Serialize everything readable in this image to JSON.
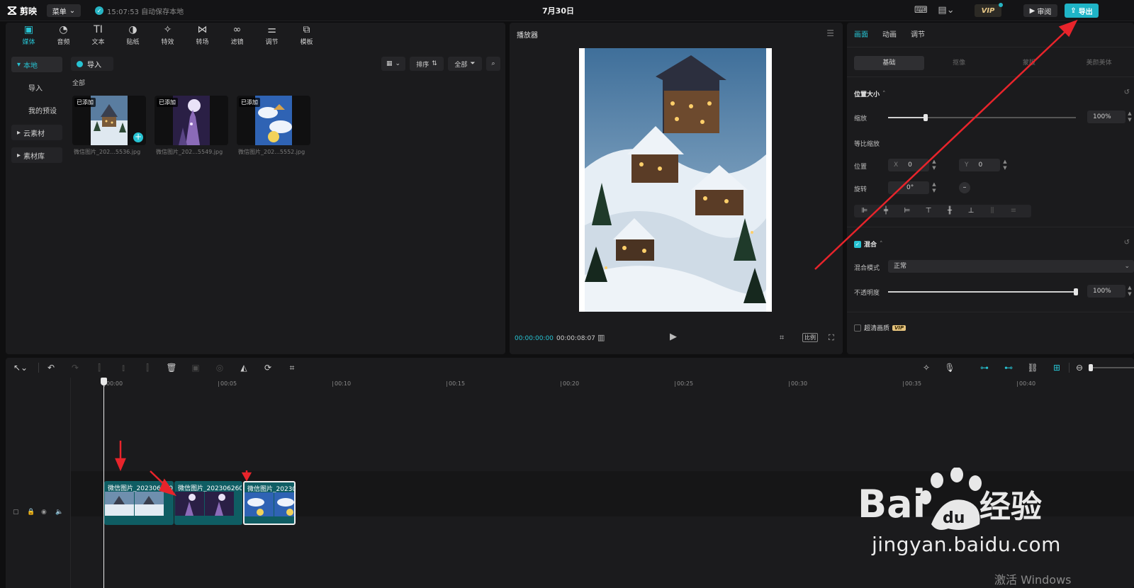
{
  "titlebar": {
    "logo": "剪映",
    "menu_label": "菜单",
    "save_status": "15:07:53 自动保存本地",
    "project_title": "7月30日",
    "vip_label": "VIP",
    "review_label": "审阅",
    "export_label": "导出"
  },
  "media": {
    "tools": [
      {
        "label": "媒体",
        "icon": "media-icon"
      },
      {
        "label": "音频",
        "icon": "audio-icon"
      },
      {
        "label": "文本",
        "icon": "text-icon"
      },
      {
        "label": "贴纸",
        "icon": "sticker-icon"
      },
      {
        "label": "特效",
        "icon": "effects-icon"
      },
      {
        "label": "转场",
        "icon": "transition-icon"
      },
      {
        "label": "滤镜",
        "icon": "filter-icon"
      },
      {
        "label": "调节",
        "icon": "adjust-icon"
      },
      {
        "label": "模板",
        "icon": "template-icon"
      }
    ],
    "nav": {
      "local": "本地",
      "import": "导入",
      "my_presets": "我的预设",
      "cloud": "云素材",
      "library": "素材库"
    },
    "import_label": "导入",
    "section_all": "全部",
    "sort_label": "排序",
    "filter_label": "全部",
    "thumbnails": [
      {
        "badge": "已添加",
        "name": "微信图片_202...5536.jpg"
      },
      {
        "badge": "已添加",
        "name": "微信图片_202...5549.jpg"
      },
      {
        "badge": "已添加",
        "name": "微信图片_202...5552.jpg"
      }
    ]
  },
  "player": {
    "title": "播放器",
    "current_time": "00:00:00:00",
    "total_time": "00:00:08:07",
    "ratio_label": "比例"
  },
  "props": {
    "tabs": [
      "画面",
      "动画",
      "调节"
    ],
    "subtabs": [
      "基础",
      "抠像",
      "蒙版",
      "美颜美体"
    ],
    "section_position": "位置大小",
    "scale_label": "缩放",
    "scale_value": "100%",
    "scale_fraction": 0.2,
    "uniform_scale_label": "等比缩放",
    "position_label": "位置",
    "pos_x_axis": "X",
    "pos_x": "0",
    "pos_y_axis": "Y",
    "pos_y": "0",
    "rotate_label": "旋转",
    "rotate_value": "0°",
    "section_blend": "混合",
    "blend_mode_label": "混合模式",
    "blend_mode_value": "正常",
    "opacity_label": "不透明度",
    "opacity_value": "100%",
    "opacity_fraction": 1.0,
    "hd_label": "超清画质",
    "hd_vip": "VIP"
  },
  "timeline": {
    "ticks": [
      "00:00",
      "00:05",
      "00:10",
      "00:15",
      "00:20",
      "00:25",
      "00:30",
      "00:35",
      "00:40"
    ],
    "cover_label": "封面",
    "clips": [
      {
        "name": "微信图片_202306260005"
      },
      {
        "name": "微信图片_202306260005"
      },
      {
        "name": "微信图片_202306"
      }
    ]
  },
  "watermark": {
    "text": "jingyan.baidu.com",
    "brand": "Bai du 经验"
  },
  "os": {
    "activate": "激活 Windows"
  },
  "colors": {
    "accent": "#27c3d3",
    "export": "#1fb4c7",
    "clip": "#0f5d63",
    "annotation": "#e8242b"
  }
}
